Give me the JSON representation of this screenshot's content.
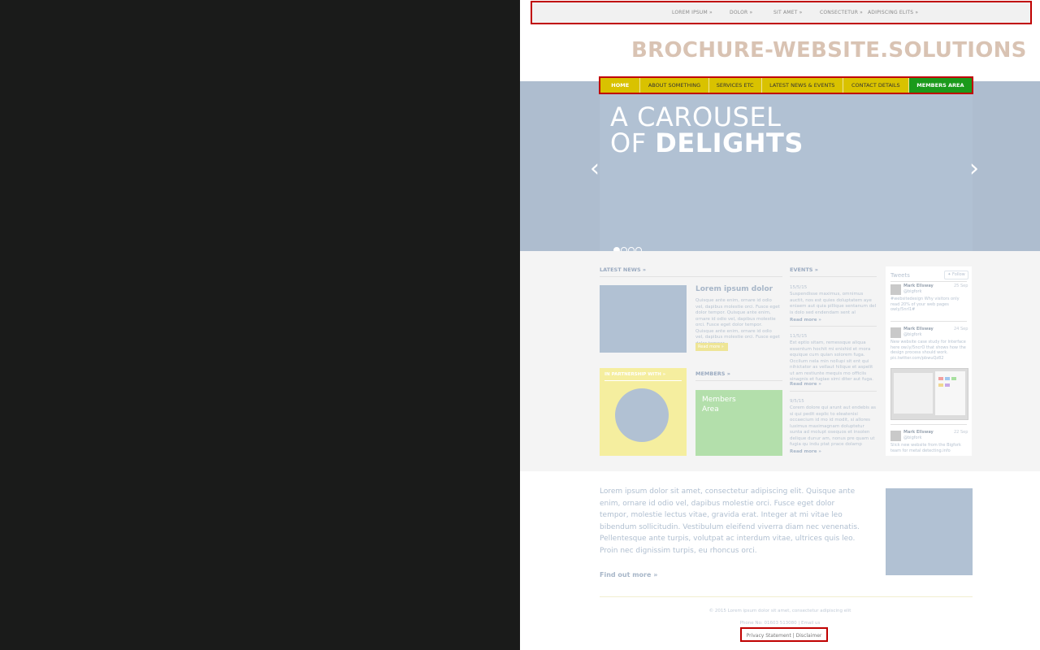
{
  "topnav": [
    "LOREM IPSUM »",
    "DOLOR »",
    "SIT AMET »",
    "CONSECTETUR »",
    "ADIPISCING ELITS »"
  ],
  "brand": "BROCHURE-WEBSITE.SOLUTIONS",
  "mainnav": [
    "HOME",
    "ABOUT SOMETHING",
    "SERVICES ETC",
    "LATEST NEWS & EVENTS",
    "CONTACT DETAILS",
    "MEMBERS AREA"
  ],
  "hero": {
    "line1": "A CAROUSEL",
    "line2_light": "OF ",
    "line2_bold": "DELIGHTS",
    "prev": "‹",
    "next": "›"
  },
  "news": {
    "heading": "LATEST NEWS »",
    "title": "Lorem ipsum dolor",
    "body": "Quisque ante enim, ornare id odio vel, dapibus molestie orci. Fusce eget dolor tempor. Quisque ante enim, ornare id odio vel, dapibus molestie orci. Fusce eget dolor tempor. Quisque ante enim, ornare id odio vel, dapibus molestie orci. Fusce eget dolor tempor.",
    "readmore": "Read more »"
  },
  "partner": {
    "heading": "IN PARTNERSHIP WITH »"
  },
  "members": {
    "heading": "MEMBERS »",
    "box": "Members\nArea"
  },
  "events": {
    "heading": "EVENTS »",
    "items": [
      {
        "date": "15/5/15",
        "text": "Suspendisse maximus, omnimus auctit, nos est quies doluptatem aye eniaem aut quia pillique sentanum del is dolo sed endendam sent al",
        "more": "Read more »"
      },
      {
        "date": "11/5/15",
        "text": "Est eptio sitam, remessque aliqua essentum hochit mi enishid et mora equique cum quian solorem fuga. Occilum nela min nollupi sit ent qui nihictator as vellaut hilique et aspelit ut am restiunte mequis mo officiis sinagnis et fugiae simi diter aut fuga.",
        "more": "Read more »"
      },
      {
        "date": "9/5/15",
        "text": "Corem dolore qui arunt aut endebis as si qui pedit explic to eleatenisi occaecium id mo id modit, si allores luximus maximagnam doluptetur sunta ad molupt osequos et insolen delique dunur am, nonus pre quam ut fugia qu indu ptat prace dolamp",
        "more": "Read more »"
      }
    ]
  },
  "tweets": {
    "heading": "Tweets",
    "follow": "Follow",
    "items": [
      {
        "name": "Mark Ellsway",
        "handle": "@bigfork",
        "date": "25 Sep",
        "text": "#websitedesign Why visitors only read 20% of your web pages owly/5nrl1#"
      },
      {
        "name": "Mark Ellsway",
        "handle": "@bigfork",
        "date": "24 Sep",
        "text": "New website case study for Interface here ow.ly/5ncrO that shows how the design process should work. pic.twitter.com/pbwuQz82"
      },
      {
        "name": "Mark Ellsway",
        "handle": "@bigfork",
        "date": "22 Sep",
        "text": "Slick new website from the Bigfork team for metal detecting.info"
      }
    ]
  },
  "lorem": "Lorem ipsum dolor sit amet, consectetur adipiscing elit. Quisque ante enim, ornare id odio vel, dapibus molestie orci. Fusce eget dolor tempor, molestie lectus vitae, gravida erat. Integer at mi vitae leo bibendum sollicitudin. Vestibulum eleifend viverra diam nec venenatis. Pellentesque ante turpis, volutpat ac interdum vitae, ultrices quis leo. Proin nec dignissim turpis, eu rhoncus orci.",
  "findmore": "Find out more »",
  "footer": {
    "copy": "© 2015 Lorem ipsum dolor sit amet, consectetur adipiscing elit",
    "phone": "Phone No: 01603 513080  |  Email us",
    "privacy": "Privacy Statement | Disclaimer"
  },
  "colors": {
    "nav_yellow": "#d9c200",
    "members_green": "#1b9a1b",
    "highlight_red": "#c00000",
    "hero_blue": "#b1c1d3"
  }
}
